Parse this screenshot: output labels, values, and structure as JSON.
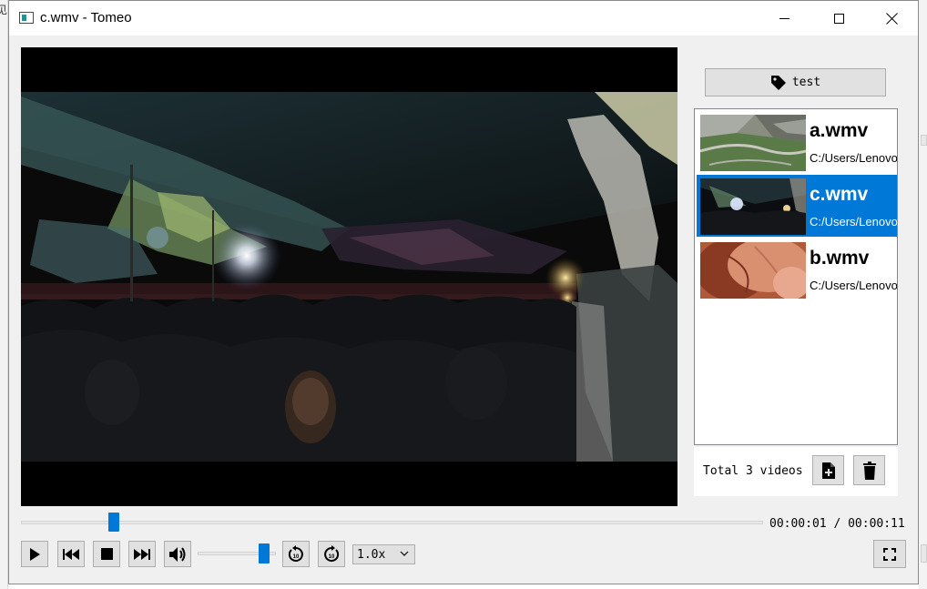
{
  "desktop": {
    "left_edge_text": "见"
  },
  "window": {
    "title": "c.wmv - Tomeo",
    "icon": "app-icon",
    "controls": [
      "minimize-icon",
      "maximize-icon",
      "close-icon"
    ]
  },
  "tag_button": {
    "label": "test",
    "icon": "tag-icon"
  },
  "video_list": {
    "items": [
      {
        "name": "a.wmv",
        "path": "C:/Users/Lenovo",
        "thumbnail": "mountain-road",
        "selected": false
      },
      {
        "name": "c.wmv",
        "path": "C:/Users/Lenovo",
        "thumbnail": "concert-crowd",
        "selected": true
      },
      {
        "name": "b.wmv",
        "path": "C:/Users/Lenovo",
        "thumbnail": "hand-closeup",
        "selected": false
      }
    ],
    "footer_text": "Total 3 videos",
    "add_icon": "file-add-icon",
    "delete_icon": "trash-icon"
  },
  "playback": {
    "current_time": "00:00:01",
    "total_time": "00:00:11",
    "time_display": "00:00:01 / 00:00:11",
    "progress_fraction": 0.12,
    "volume_fraction": 0.9,
    "speed": "1.0x"
  },
  "controls": {
    "icons": [
      "play-icon",
      "previous-icon",
      "stop-icon",
      "next-icon",
      "volume-icon",
      "rewind-10-icon",
      "forward-10-icon",
      "fullscreen-icon"
    ]
  },
  "colors": {
    "accent": "#0078d7",
    "selection_text": "#ffffff",
    "button_face": "#e1e1e1"
  }
}
